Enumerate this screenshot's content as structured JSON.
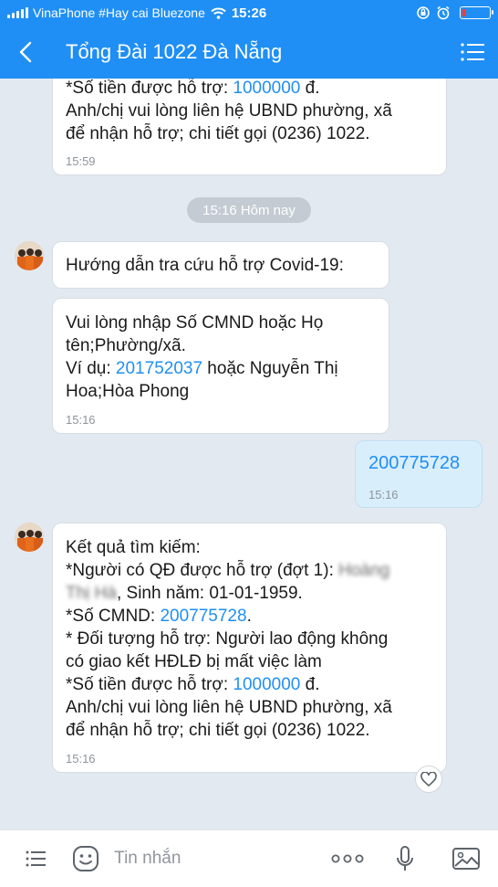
{
  "status_bar": {
    "carrier": "VinaPhone #Hay cai Bluezone",
    "time": "15:26",
    "battery_level": 0.12
  },
  "header": {
    "title": "Tổng Đài 1022 Đà Nẵng"
  },
  "messages": {
    "prev": {
      "line1_prefix": "*Số tiền được hỗ trợ: ",
      "line1_amount": "1000000",
      "line1_suffix": " đ.",
      "line2": "Anh/chị vui lòng liên hệ UBND phường, xã",
      "line3": "để nhận hỗ trợ; chi tiết gọi (0236) 1022.",
      "time": "15:59"
    },
    "date_divider": "15:16 Hôm nay",
    "guide_title": {
      "text": "Hướng dẫn tra cứu hỗ trợ Covid-19:"
    },
    "guide_body": {
      "line1": "Vui lòng nhập Số CMND hoặc Họ",
      "line2": "tên;Phường/xã.",
      "line3_prefix": "Ví dụ: ",
      "line3_number": "201752037",
      "line3_suffix": " hoặc Nguyễn Thị",
      "line4": "Hoa;Hòa Phong",
      "time": "15:16"
    },
    "user_query": {
      "text": "200775728",
      "time": "15:16"
    },
    "result": {
      "line1": "Kết quả tìm kiếm:",
      "line2_prefix": "*Người có QĐ được hỗ trợ (đợt 1): ",
      "line2_blur": "Hoàng",
      "line3_blur": "Thị Hà",
      "line3_suffix": ", Sinh năm: 01-01-1959.",
      "line4_prefix": "*Số CMND: ",
      "line4_number": "200775728",
      "line4_suffix": ".",
      "line5": "* Đối tượng hỗ trợ: Người lao động không",
      "line6": "có giao kết HĐLĐ bị mất việc làm",
      "line7_prefix": "*Số tiền được hỗ trợ: ",
      "line7_amount": "1000000",
      "line7_suffix": " đ.",
      "line8": "Anh/chị vui lòng liên hệ UBND phường, xã",
      "line9": "để nhận hỗ trợ; chi tiết gọi (0236) 1022.",
      "time": "15:16"
    }
  },
  "input_bar": {
    "placeholder": "Tin nhắn"
  },
  "colors": {
    "brand": "#1f8ff5",
    "chat_bg": "#e2e9f1",
    "my_bubble": "#d9eefb",
    "link_number": "#1f8ff5"
  },
  "icons": [
    "back-arrow-icon",
    "menu-icon",
    "heart-icon",
    "list-icon",
    "emoji-icon",
    "more-icon",
    "microphone-icon",
    "image-icon",
    "wifi-icon",
    "alarm-icon",
    "rotation-lock-icon"
  ]
}
